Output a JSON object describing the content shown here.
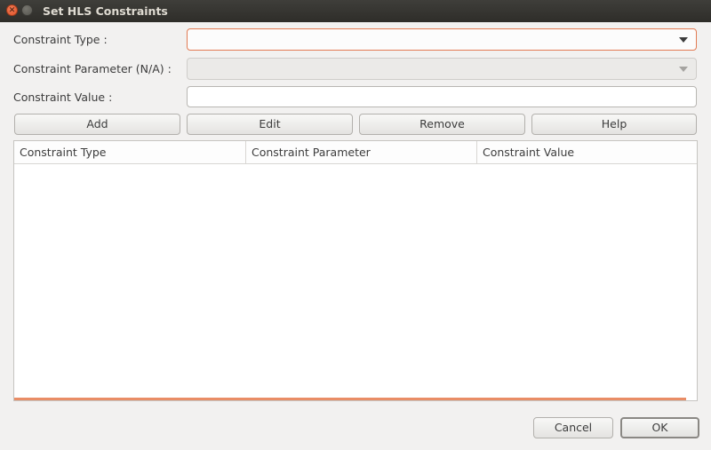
{
  "window": {
    "title": "Set HLS Constraints"
  },
  "form": {
    "constraint_type_label": "Constraint Type :",
    "constraint_type_value": "",
    "constraint_parameter_label": "Constraint Parameter (N/A) :",
    "constraint_parameter_value": "",
    "constraint_value_label": "Constraint Value :",
    "constraint_value_value": ""
  },
  "actions": {
    "add": "Add",
    "edit": "Edit",
    "remove": "Remove",
    "help": "Help"
  },
  "table": {
    "columns": [
      "Constraint Type",
      "Constraint Parameter",
      "Constraint Value"
    ],
    "rows": []
  },
  "footer": {
    "cancel": "Cancel",
    "ok": "OK"
  },
  "colors": {
    "accent": "#e27b53",
    "titlebar": "#3a3935",
    "background": "#f2f1f0"
  }
}
